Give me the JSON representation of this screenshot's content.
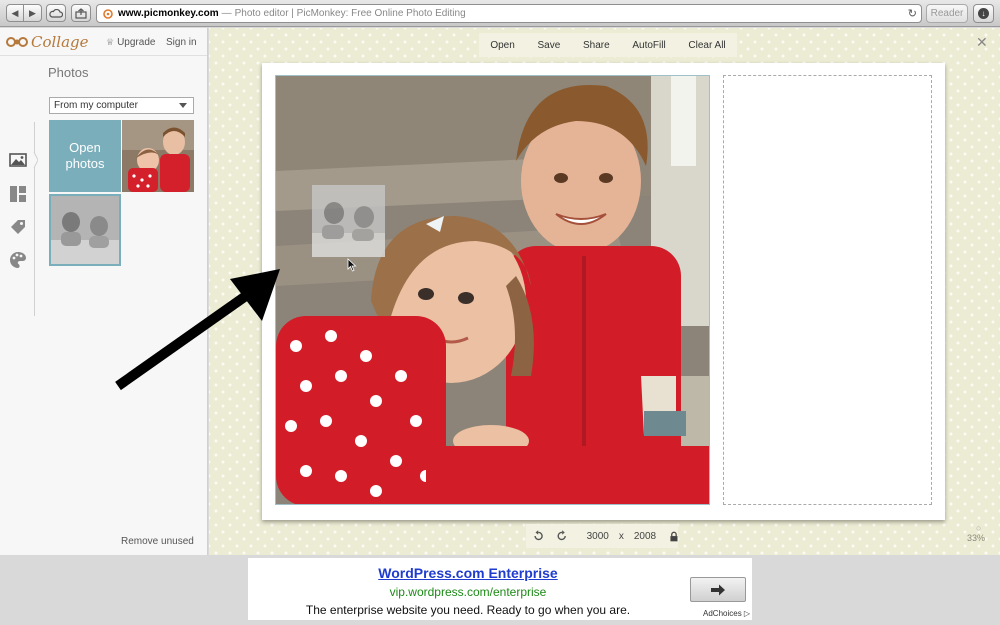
{
  "browser": {
    "url_host": "www.picmonkey.com",
    "url_separator": "—",
    "page_title": "Photo editor | PicMonkey: Free Online Photo Editing",
    "reader_label": "Reader"
  },
  "sidebar": {
    "logo_text": "Collage",
    "upgrade_label": "Upgrade",
    "signin_label": "Sign in",
    "panel_title": "Photos",
    "source_select_value": "From my computer",
    "open_photos_label": "Open photos",
    "remove_unused_label": "Remove unused",
    "rail_icons": [
      "image-icon",
      "layout-icon",
      "tag-icon",
      "palette-icon"
    ]
  },
  "toolbar": {
    "open_label": "Open",
    "save_label": "Save",
    "share_label": "Share",
    "autofill_label": "AutoFill",
    "clear_all_label": "Clear All"
  },
  "canvas": {
    "width_value": "3000",
    "times_sign": "x",
    "height_value": "2008",
    "zoom_level": "33%"
  },
  "ad": {
    "title": "WordPress.com Enterprise",
    "url": "vip.wordpress.com/enterprise",
    "description": "The enterprise website you need. Ready to go when you are.",
    "adchoices_label": "AdChoices"
  },
  "colors": {
    "accent_teal": "#7aaebb",
    "workspace_bg": "#ecebd3",
    "brand_orange": "#b5793b",
    "ad_title": "#1f3ccf",
    "ad_url": "#1d8a17"
  }
}
